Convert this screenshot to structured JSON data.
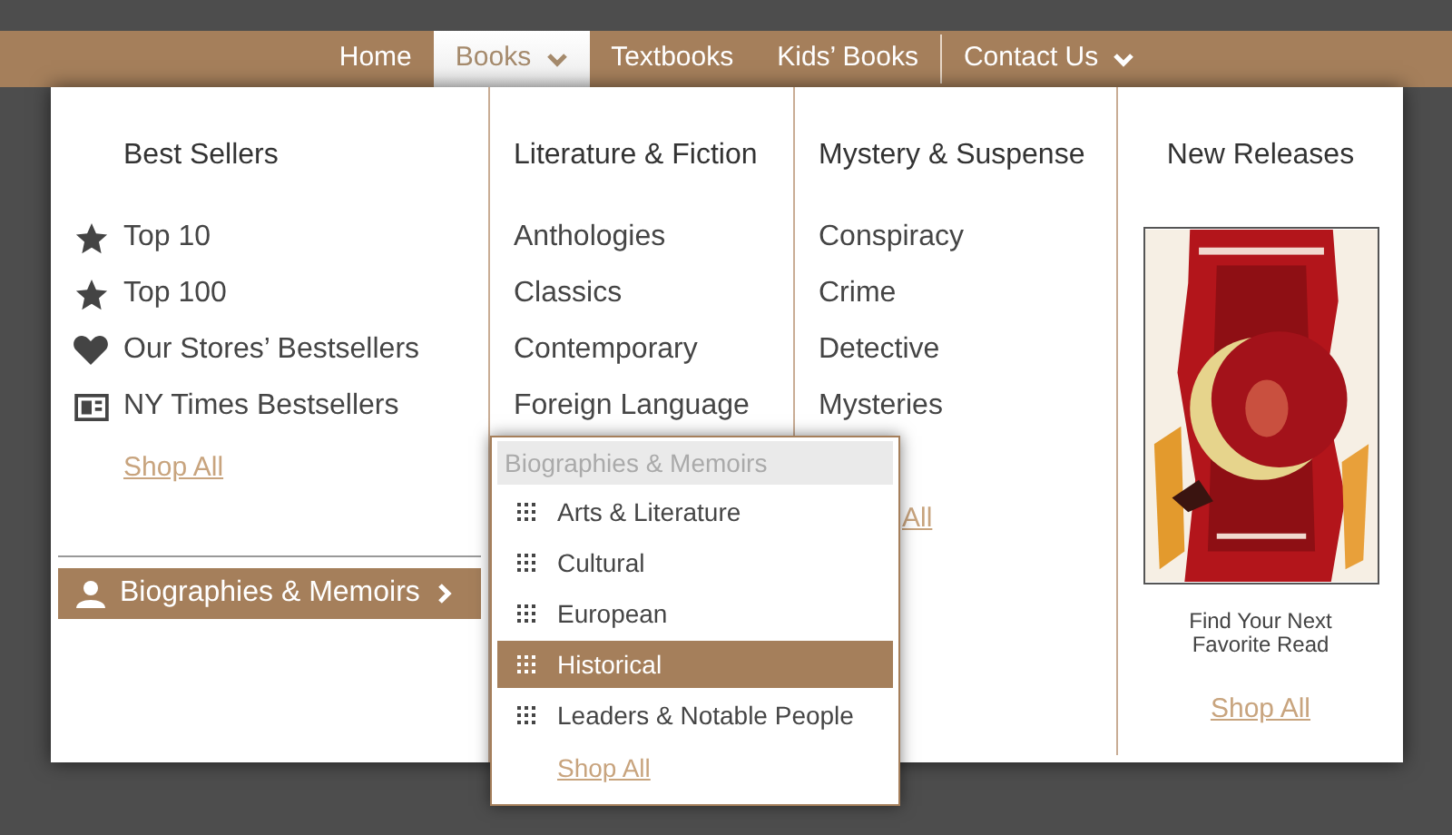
{
  "nav": [
    {
      "label": "Home",
      "selected": false,
      "dropdown": false,
      "divider_before": false
    },
    {
      "label": "Books",
      "selected": true,
      "dropdown": true,
      "divider_before": false
    },
    {
      "label": "Textbooks",
      "selected": false,
      "dropdown": false,
      "divider_before": false
    },
    {
      "label": "Kids’ Books",
      "selected": false,
      "dropdown": false,
      "divider_before": false
    },
    {
      "label": "Contact Us",
      "selected": false,
      "dropdown": true,
      "divider_before": true
    }
  ],
  "best_sellers": {
    "heading": "Best Sellers",
    "items": [
      {
        "label": "Top 10",
        "kind": "star"
      },
      {
        "label": "Top 100",
        "kind": "star"
      },
      {
        "label": "Our Stores’ Bestsellers",
        "kind": "heart"
      },
      {
        "label": "NY Times Bestsellers",
        "kind": "newspaper"
      }
    ],
    "shop_all": "Shop All",
    "category": {
      "label": "Biographies & Memoirs",
      "selected": true
    }
  },
  "literature": {
    "heading": "Literature & Fiction",
    "items": [
      "Anthologies",
      "Classics",
      "Contemporary",
      "Foreign Language"
    ]
  },
  "mystery": {
    "heading": "Mystery & Suspense",
    "items": [
      "Conspiracy",
      "Crime",
      "Detective",
      "Mysteries"
    ],
    "shop_all": "All"
  },
  "new_releases": {
    "heading": "New Releases",
    "caption": "Find Your Next Favorite Read",
    "shop_all": "Shop All"
  },
  "flyout": {
    "title": "Biographies & Memoirs",
    "items": [
      {
        "label": "Arts & Literature",
        "selected": false
      },
      {
        "label": "Cultural",
        "selected": false
      },
      {
        "label": "European",
        "selected": false
      },
      {
        "label": "Historical",
        "selected": true
      },
      {
        "label": "Leaders & Notable People",
        "selected": false
      }
    ],
    "shop_all": "Shop All"
  }
}
